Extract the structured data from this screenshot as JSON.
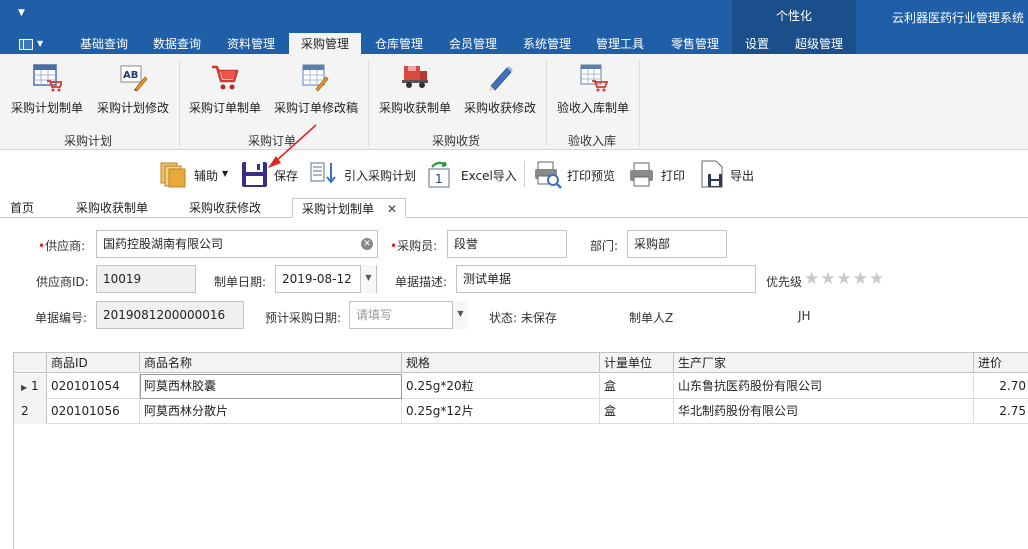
{
  "title_bar": {
    "quick_access_arrow": "▼",
    "personalize_label": "个性化",
    "app_title": "云利器医药行业管理系统"
  },
  "menu_tabs": [
    {
      "label": "基础查询"
    },
    {
      "label": "数据查询"
    },
    {
      "label": "资料管理"
    },
    {
      "label": "采购管理"
    },
    {
      "label": "仓库管理"
    },
    {
      "label": "会员管理"
    },
    {
      "label": "系统管理"
    },
    {
      "label": "管理工具"
    },
    {
      "label": "零售管理"
    },
    {
      "label": "设置"
    },
    {
      "label": "超级管理"
    }
  ],
  "active_menu_tab": "采购管理",
  "ribbon": {
    "buttons": [
      {
        "label": "采购计划制单",
        "icon": "calendar-cart-icon"
      },
      {
        "label": "采购计划修改",
        "icon": "ab-edit-icon"
      },
      {
        "label": "采购订单制单",
        "icon": "cart-icon"
      },
      {
        "label": "采购订单修改稿",
        "icon": "grid-edit-icon"
      },
      {
        "label": "采购收获制单",
        "icon": "truck-icon"
      },
      {
        "label": "采购收获修改",
        "icon": "pencil-icon"
      },
      {
        "label": "验收入库制单",
        "icon": "table-cart-icon"
      }
    ],
    "groups": [
      {
        "label": "采购计划"
      },
      {
        "label": "采购订单"
      },
      {
        "label": "采购收货"
      },
      {
        "label": "验收入库"
      }
    ]
  },
  "toolbar": {
    "assist_label": "辅助",
    "save_label": "保存",
    "import_plan_label": "引入采购计划",
    "excel_import_label": "Excel导入",
    "print_preview_label": "打印预览",
    "print_label": "打印",
    "export_label": "导出"
  },
  "doc_tabs": [
    {
      "label": "首页"
    },
    {
      "label": "采购收获制单"
    },
    {
      "label": "采购收获修改"
    },
    {
      "label": "采购计划制单"
    }
  ],
  "form": {
    "supplier_label": "供应商:",
    "supplier_value": "国药控股湖南有限公司",
    "buyer_label": "采购员:",
    "buyer_value": "段誉",
    "dept_label": "部门:",
    "dept_value": "采购部",
    "supplier_id_label": "供应商ID:",
    "supplier_id_value": "10019",
    "bill_date_label": "制单日期:",
    "bill_date_value": "2019-08-12",
    "bill_desc_label": "单据描述:",
    "bill_desc_value": "测试单据",
    "priority_label": "优先级",
    "priority_stars": "★★★★★",
    "bill_no_label": "单据编号:",
    "bill_no_value": "2019081200000016",
    "expected_date_label": "预计采购日期:",
    "expected_date_placeholder": "请填写",
    "status_label": "状态:",
    "status_value": "未保存",
    "creator_label": "制单人Z",
    "creator_value": "JH",
    "required_mark": "•"
  },
  "grid": {
    "columns": [
      "商品ID",
      "商品名称",
      "规格",
      "计量单位",
      "生产厂家",
      "进价"
    ],
    "rows": [
      {
        "row_no": "1",
        "id": "020101054",
        "name": "阿莫西林胶囊",
        "spec": "0.25g*20粒",
        "unit": "盒",
        "maker": "山东鲁抗医药股份有限公司",
        "price": "2.70"
      },
      {
        "row_no": "2",
        "id": "020101056",
        "name": "阿莫西林分散片",
        "spec": "0.25g*12片",
        "unit": "盒",
        "maker": "华北制药股份有限公司",
        "price": "2.75"
      }
    ]
  },
  "colors": {
    "title_bar": "#1f5fa8",
    "personalize_bg": "#1a4f8c",
    "required_mark": "#e0271f",
    "annotation_arrow": "#e0271f"
  }
}
